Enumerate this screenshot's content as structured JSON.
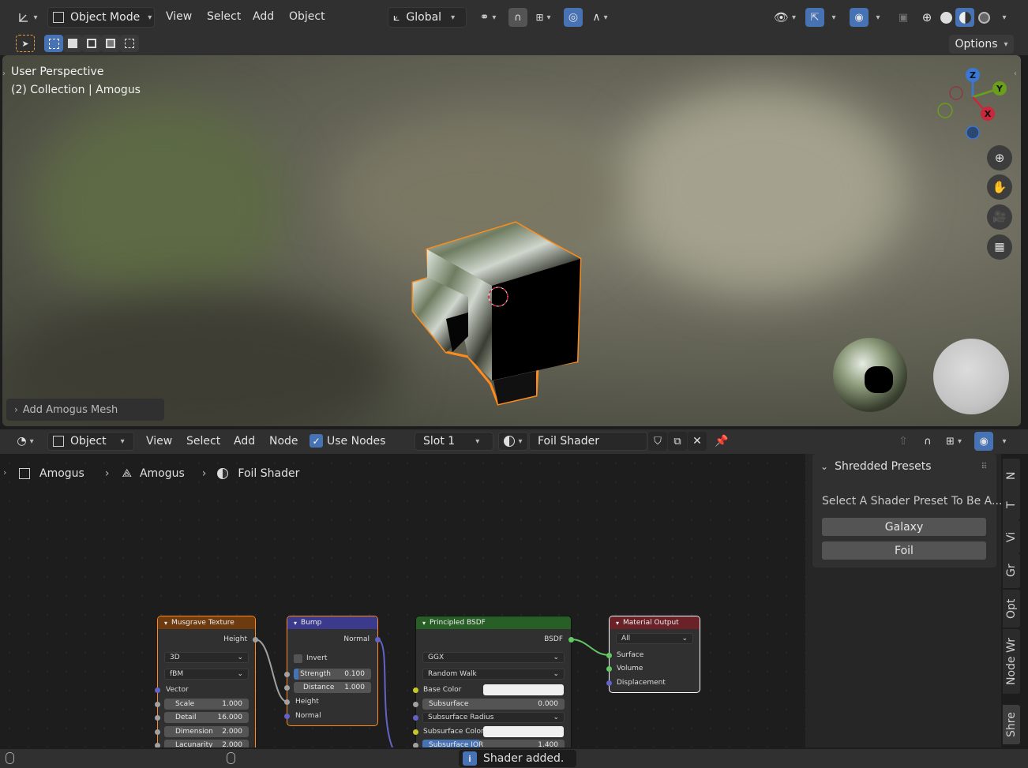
{
  "viewport_header": {
    "mode": "Object Mode",
    "menus": [
      "View",
      "Select",
      "Add",
      "Object"
    ],
    "orientation": "Global",
    "options_label": "Options"
  },
  "viewport": {
    "view_name": "User Perspective",
    "collection_info": "(2) Collection | Amogus",
    "last_operator": "Add Amogus Mesh",
    "gizmo_axes": [
      "Z",
      "Y",
      "X"
    ]
  },
  "node_header": {
    "editor_type": "Object",
    "menus": [
      "View",
      "Select",
      "Add",
      "Node"
    ],
    "use_nodes_label": "Use Nodes",
    "use_nodes_checked": true,
    "slot": "Slot 1",
    "material_name": "Foil Shader"
  },
  "breadcrumb": [
    "Amogus",
    "Amogus",
    "Foil Shader"
  ],
  "nodes": {
    "musgrave": {
      "title": "Musgrave Texture",
      "output": "Height",
      "dims": "3D",
      "type": "fBM",
      "input_vector": "Vector",
      "fields": [
        {
          "label": "Scale",
          "value": "1.000"
        },
        {
          "label": "Detail",
          "value": "16.000"
        },
        {
          "label": "Dimension",
          "value": "2.000"
        },
        {
          "label": "Lacunarity",
          "value": "2.000"
        }
      ]
    },
    "bump": {
      "title": "Bump",
      "output": "Normal",
      "invert_label": "Invert",
      "fields": [
        {
          "label": "Strength",
          "value": "0.100"
        },
        {
          "label": "Distance",
          "value": "1.000"
        }
      ],
      "inputs": [
        "Height",
        "Normal"
      ]
    },
    "bsdf": {
      "title": "Principled BSDF",
      "output": "BSDF",
      "distribution": "GGX",
      "subsurface_method": "Random Walk",
      "base_color_label": "Base Color",
      "subsurface_label": "Subsurface",
      "subsurface_value": "0.000",
      "subsurface_radius_label": "Subsurface Radius",
      "subsurface_color_label": "Subsurface Color",
      "subsurface_ior_label": "Subsurface IOR",
      "subsurface_ior_value": "1.400"
    },
    "output": {
      "title": "Material Output",
      "target": "All",
      "inputs": [
        "Surface",
        "Volume",
        "Displacement"
      ]
    }
  },
  "side_panel": {
    "title": "Shredded Presets",
    "description": "Select A Shader Preset To Be A...",
    "buttons": [
      "Galaxy",
      "Foil"
    ],
    "tabs": [
      "N",
      "T",
      "Vi",
      "Gr",
      "Opt",
      "Node Wr",
      "Shre"
    ]
  },
  "status": {
    "message": "Shader added."
  },
  "colors": {
    "accent": "#4772b3",
    "musgrave_header": "#6e3a0f",
    "bump_header": "#3b3a8c",
    "bsdf_header": "#275f27",
    "output_header": "#6a2127",
    "selection": "#ff8c1a"
  }
}
